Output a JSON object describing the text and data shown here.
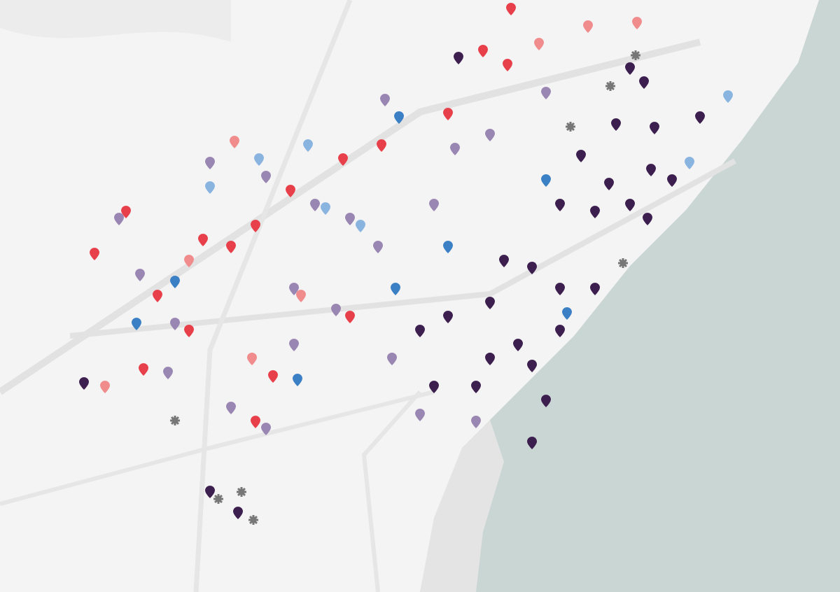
{
  "markers": [
    {
      "kind": "pin",
      "color": "#3d1f4f"
    },
    {
      "kind": "pin",
      "color": "#3d1f4f"
    },
    {
      "kind": "pin",
      "color": "#3d1f4f"
    },
    {
      "kind": "pin",
      "color": "#3d1f4f"
    },
    {
      "kind": "pin",
      "color": "#3d1f4f"
    },
    {
      "kind": "pin",
      "color": "#3d1f4f"
    },
    {
      "kind": "pin",
      "color": "#3d1f4f"
    },
    {
      "kind": "pin",
      "color": "#3d1f4f"
    },
    {
      "kind": "pin",
      "color": "#3d1f4f"
    },
    {
      "kind": "pin",
      "color": "#3d1f4f"
    },
    {
      "kind": "pin",
      "color": "#3d1f4f"
    },
    {
      "kind": "pin",
      "color": "#3d1f4f"
    },
    {
      "kind": "pin",
      "color": "#3d1f4f"
    },
    {
      "kind": "pin",
      "color": "#3d1f4f"
    },
    {
      "kind": "pin",
      "color": "#3d1f4f"
    },
    {
      "kind": "pin",
      "color": "#3d1f4f"
    },
    {
      "kind": "pin",
      "color": "#3d1f4f"
    },
    {
      "kind": "pin",
      "color": "#3d1f4f"
    },
    {
      "kind": "pin",
      "color": "#3d1f4f"
    },
    {
      "kind": "pin",
      "color": "#3d1f4f"
    },
    {
      "kind": "pin",
      "color": "#3d1f4f"
    },
    {
      "kind": "pin",
      "color": "#3d1f4f"
    },
    {
      "kind": "pin",
      "color": "#3d1f4f"
    },
    {
      "kind": "pin",
      "color": "#3d1f4f"
    },
    {
      "kind": "pin",
      "color": "#3d1f4f"
    },
    {
      "kind": "pin",
      "color": "#3d1f4f"
    },
    {
      "kind": "pin",
      "color": "#3d1f4f"
    },
    {
      "kind": "pin",
      "color": "#3d1f4f"
    },
    {
      "kind": "pin",
      "color": "#3d1f4f"
    },
    {
      "kind": "pin",
      "color": "#3d1f4f"
    },
    {
      "kind": "pin",
      "color": "#3d1f4f"
    },
    {
      "kind": "pin",
      "color": "#3d1f4f"
    },
    {
      "kind": "pin",
      "color": "#9a86b3"
    },
    {
      "kind": "pin",
      "color": "#9a86b3"
    },
    {
      "kind": "pin",
      "color": "#9a86b3"
    },
    {
      "kind": "pin",
      "color": "#9a86b3"
    },
    {
      "kind": "pin",
      "color": "#9a86b3"
    },
    {
      "kind": "pin",
      "color": "#9a86b3"
    },
    {
      "kind": "pin",
      "color": "#9a86b3"
    },
    {
      "kind": "pin",
      "color": "#9a86b3"
    },
    {
      "kind": "pin",
      "color": "#9a86b3"
    },
    {
      "kind": "pin",
      "color": "#9a86b3"
    },
    {
      "kind": "pin",
      "color": "#9a86b3"
    },
    {
      "kind": "pin",
      "color": "#9a86b3"
    },
    {
      "kind": "pin",
      "color": "#9a86b3"
    },
    {
      "kind": "pin",
      "color": "#9a86b3"
    },
    {
      "kind": "pin",
      "color": "#9a86b3"
    },
    {
      "kind": "pin",
      "color": "#9a86b3"
    },
    {
      "kind": "pin",
      "color": "#9a86b3"
    },
    {
      "kind": "pin",
      "color": "#9a86b3"
    },
    {
      "kind": "pin",
      "color": "#9a86b3"
    },
    {
      "kind": "pin",
      "color": "#9a86b3"
    },
    {
      "kind": "pin",
      "color": "#9a86b3"
    },
    {
      "kind": "pin",
      "color": "#9a86b3"
    },
    {
      "kind": "pin",
      "color": "#e8404a"
    },
    {
      "kind": "pin",
      "color": "#e8404a"
    },
    {
      "kind": "pin",
      "color": "#e8404a"
    },
    {
      "kind": "pin",
      "color": "#e8404a"
    },
    {
      "kind": "pin",
      "color": "#e8404a"
    },
    {
      "kind": "pin",
      "color": "#e8404a"
    },
    {
      "kind": "pin",
      "color": "#e8404a"
    },
    {
      "kind": "pin",
      "color": "#e8404a"
    },
    {
      "kind": "pin",
      "color": "#e8404a"
    },
    {
      "kind": "pin",
      "color": "#e8404a"
    },
    {
      "kind": "pin",
      "color": "#e8404a"
    },
    {
      "kind": "pin",
      "color": "#e8404a"
    },
    {
      "kind": "pin",
      "color": "#e8404a"
    },
    {
      "kind": "pin",
      "color": "#e8404a"
    },
    {
      "kind": "pin",
      "color": "#e8404a"
    },
    {
      "kind": "pin",
      "color": "#e8404a"
    },
    {
      "kind": "pin",
      "color": "#e8404a"
    },
    {
      "kind": "pin",
      "color": "#e8404a"
    },
    {
      "kind": "pin",
      "color": "#f08c8c"
    },
    {
      "kind": "pin",
      "color": "#f08c8c"
    },
    {
      "kind": "pin",
      "color": "#f08c8c"
    },
    {
      "kind": "pin",
      "color": "#f08c8c"
    },
    {
      "kind": "pin",
      "color": "#f08c8c"
    },
    {
      "kind": "pin",
      "color": "#f08c8c"
    },
    {
      "kind": "pin",
      "color": "#f08c8c"
    },
    {
      "kind": "pin",
      "color": "#f08c8c"
    },
    {
      "kind": "pin",
      "color": "#3b7fc4"
    },
    {
      "kind": "pin",
      "color": "#3b7fc4"
    },
    {
      "kind": "pin",
      "color": "#3b7fc4"
    },
    {
      "kind": "pin",
      "color": "#3b7fc4"
    },
    {
      "kind": "pin",
      "color": "#3b7fc4"
    },
    {
      "kind": "pin",
      "color": "#3b7fc4"
    },
    {
      "kind": "pin",
      "color": "#3b7fc4"
    },
    {
      "kind": "pin",
      "color": "#3b7fc4"
    },
    {
      "kind": "pin",
      "color": "#8ab4e0"
    },
    {
      "kind": "pin",
      "color": "#8ab4e0"
    },
    {
      "kind": "pin",
      "color": "#8ab4e0"
    },
    {
      "kind": "pin",
      "color": "#8ab4e0"
    },
    {
      "kind": "pin",
      "color": "#8ab4e0"
    },
    {
      "kind": "pin",
      "color": "#8ab4e0"
    },
    {
      "kind": "pin",
      "color": "#8ab4e0"
    },
    {
      "kind": "gear",
      "color": "#777777"
    },
    {
      "kind": "gear",
      "color": "#777777"
    },
    {
      "kind": "gear",
      "color": "#777777"
    },
    {
      "kind": "gear",
      "color": "#777777"
    },
    {
      "kind": "gear",
      "color": "#777777"
    },
    {
      "kind": "gear",
      "color": "#777777"
    },
    {
      "kind": "gear",
      "color": "#777777"
    },
    {
      "kind": "gear",
      "color": "#777777"
    }
  ]
}
